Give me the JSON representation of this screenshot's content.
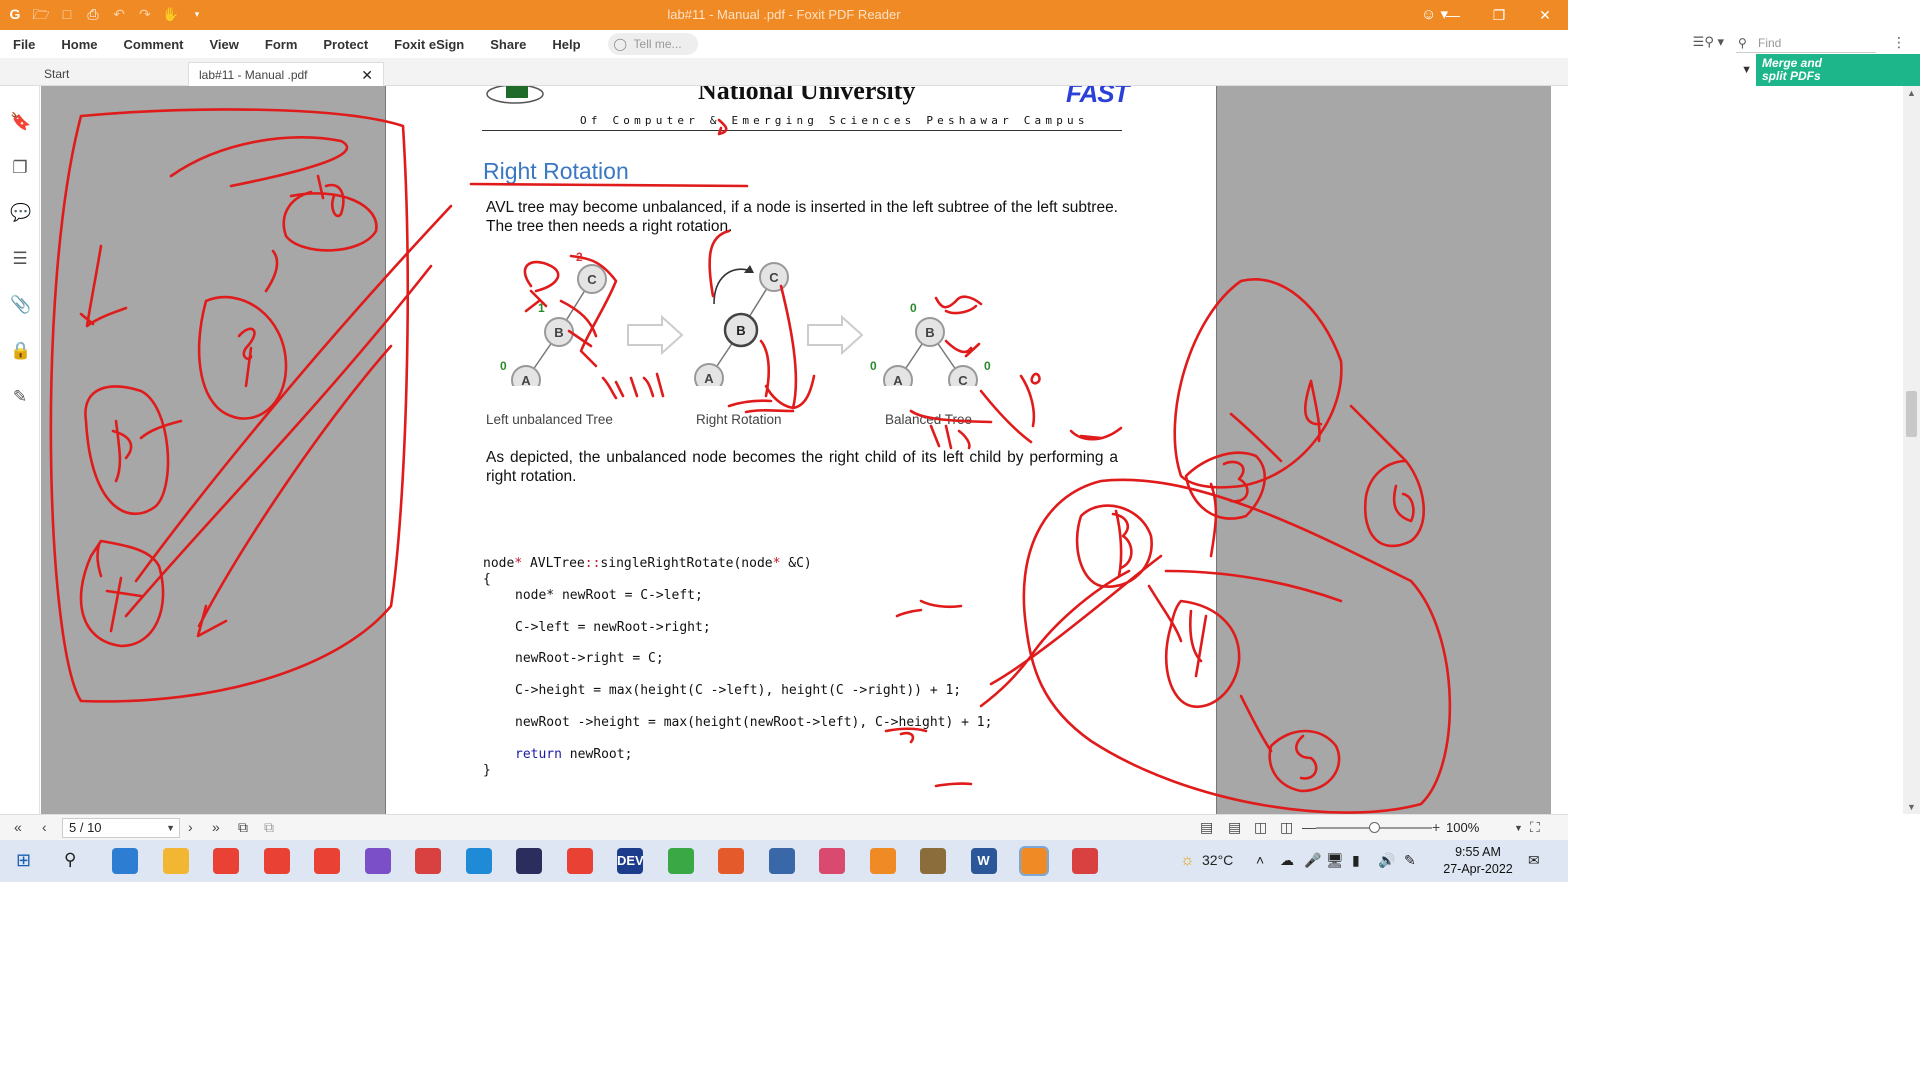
{
  "window": {
    "title": "lab#11 - Manual .pdf - Foxit PDF Reader"
  },
  "menu": [
    "File",
    "Home",
    "Comment",
    "View",
    "Form",
    "Protect",
    "Foxit eSign",
    "Share",
    "Help"
  ],
  "tell_me_placeholder": "Tell me...",
  "find_placeholder": "Find",
  "tabs": {
    "start": "Start",
    "active": "lab#11 - Manual .pdf"
  },
  "promo": {
    "line1": "Merge and",
    "line2": "split PDFs"
  },
  "document": {
    "university": "National University",
    "campus": "Of Computer & Emerging Sciences Peshawar Campus",
    "logo_right": "FAST",
    "section_heading": "Right Rotation",
    "para1": "AVL tree may become unbalanced, if a node is inserted in the left subtree of the left subtree. The tree then needs a right rotation.",
    "para2": "As depicted, the unbalanced node becomes the right child of its left child by performing a right rotation.",
    "diagram": {
      "captions": [
        "Left unbalanced Tree",
        "Right Rotation",
        "Balanced Tree"
      ],
      "tree1": {
        "nodes": [
          "C",
          "B",
          "A"
        ],
        "balance_labels": [
          "2",
          "1",
          "0"
        ]
      },
      "tree2": {
        "nodes": [
          "C",
          "B",
          "A"
        ]
      },
      "tree3": {
        "nodes": [
          "B",
          "A",
          "C"
        ],
        "balance_labels": [
          "0",
          "0",
          "0"
        ]
      }
    },
    "code": {
      "l1_type": "node",
      "l1_star": "*",
      "l1_class": " AVLTree",
      "l1_scope": "::",
      "l1_fn": "singleRightRotate(node",
      "l1_star2": "*",
      "l1_end": " &C)",
      "l2": "{",
      "l3": "node* newRoot = C->left;",
      "l4": "C->left = newRoot->right;",
      "l5": "newRoot->right = C;",
      "l6": "C->height = max(height(C ->left), height(C ->right)) + 1;",
      "l7": "newRoot ->height = max(height(newRoot->left), C->height) + 1;",
      "l8_kw": "return",
      "l8_rest": " newRoot;",
      "l9": "}"
    }
  },
  "statusbar": {
    "page": "5 / 10",
    "zoom": "100%",
    "zoom_fraction": 0.5
  },
  "taskbar": {
    "weather": "32°C",
    "time": "9:55 AM",
    "date": "27-Apr-2022",
    "apps": [
      {
        "name": "app-icon",
        "color": "#2d7dd2"
      },
      {
        "name": "file-explorer",
        "color": "#f2b632"
      },
      {
        "name": "chrome",
        "color": "#e94235"
      },
      {
        "name": "chrome-profile-2",
        "color": "#e94235"
      },
      {
        "name": "chrome-profile-3",
        "color": "#e94235"
      },
      {
        "name": "visual-studio",
        "color": "#7a4fc7"
      },
      {
        "name": "dvd-app",
        "color": "#d94040"
      },
      {
        "name": "vs-code",
        "color": "#1f8ad6"
      },
      {
        "name": "eclipse",
        "color": "#2b2e5c"
      },
      {
        "name": "chrome-profile-4",
        "color": "#e94235"
      },
      {
        "name": "dev-cpp",
        "color": "#1c3c8c"
      },
      {
        "name": "camtasia-green",
        "color": "#3aa845"
      },
      {
        "name": "camtasia-red",
        "color": "#e55a2b"
      },
      {
        "name": "virtualbox",
        "color": "#3a67a8"
      },
      {
        "name": "snip-tool",
        "color": "#d94a6e"
      },
      {
        "name": "xampp",
        "color": "#f08a24"
      },
      {
        "name": "dosbox",
        "color": "#8a6d3b"
      },
      {
        "name": "word",
        "color": "#2b579a"
      },
      {
        "name": "foxit-reader",
        "color": "#f08a24"
      },
      {
        "name": "paint-app",
        "color": "#d94040"
      }
    ],
    "app_labels": {
      "dev-cpp": "DEV",
      "word": "W"
    }
  },
  "colors": {
    "titlebar": "#f08a24",
    "ink": "#e01b1b",
    "heading": "#3a78c2",
    "promo": "#1db68a"
  }
}
